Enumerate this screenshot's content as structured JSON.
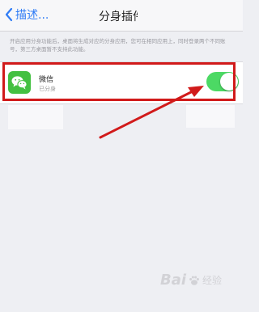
{
  "navbar": {
    "back_label": "描述...",
    "title": "分身插件"
  },
  "description": "开启应用分身功能后，桌面将生成对应的分身应用，您可在相同应用上，同时登录两个不同账号，第三方桌面暂不支持此功能。",
  "app": {
    "name": "微信",
    "status": "已分身",
    "toggle_on": true
  },
  "colors": {
    "accent": "#2f7cf6",
    "toggle_on": "#4cd964",
    "annotation_red": "#d11a1a",
    "wechat_green": "#43c041"
  },
  "icons": {
    "back": "chevron-left-icon",
    "app": "wechat-icon"
  },
  "watermark": {
    "brand": "Bai",
    "suffix": "经验"
  }
}
